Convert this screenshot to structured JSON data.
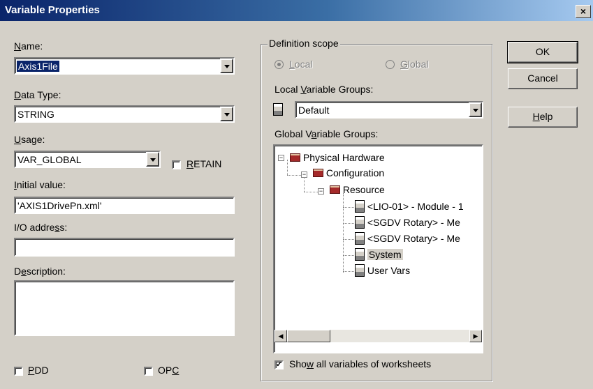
{
  "window": {
    "title": "Variable Properties",
    "close_glyph": "×"
  },
  "left": {
    "name_label": "Name:",
    "name_value": "Axis1File",
    "datatype_label": "Data Type:",
    "datatype_value": "STRING",
    "usage_label": "Usage:",
    "usage_value": "VAR_GLOBAL",
    "retain_label": "RETAIN",
    "initial_label": "Initial value:",
    "initial_value": "'AXIS1DrivePn.xml'",
    "io_label": "I/O address:",
    "io_value": "",
    "description_label": "Description:",
    "description_value": "",
    "pdd_label": "PDD",
    "opc_label": "OPC"
  },
  "scope": {
    "legend": "Definition scope",
    "local_label": "Local",
    "global_label": "Global",
    "local_groups_label": "Local Variable Groups:",
    "local_groups_value": "Default",
    "global_groups_label": "Global Variable Groups:",
    "tree": [
      {
        "label": "Physical Hardware",
        "icon": "folder-icon"
      },
      {
        "label": "Configuration",
        "icon": "folder-icon"
      },
      {
        "label": "Resource",
        "icon": "folder-icon"
      },
      {
        "label": "<LIO-01> - Module - 1",
        "icon": "cabinet-icon"
      },
      {
        "label": "<SGDV Rotary> - Me",
        "icon": "cabinet-icon"
      },
      {
        "label": "<SGDV Rotary> - Me",
        "icon": "cabinet-icon"
      },
      {
        "label": "System",
        "icon": "cabinet-icon"
      },
      {
        "label": "User Vars",
        "icon": "cabinet-icon"
      }
    ],
    "show_all_label": "Show all variables of worksheets"
  },
  "buttons": {
    "ok": "OK",
    "cancel": "Cancel",
    "help": "Help"
  }
}
